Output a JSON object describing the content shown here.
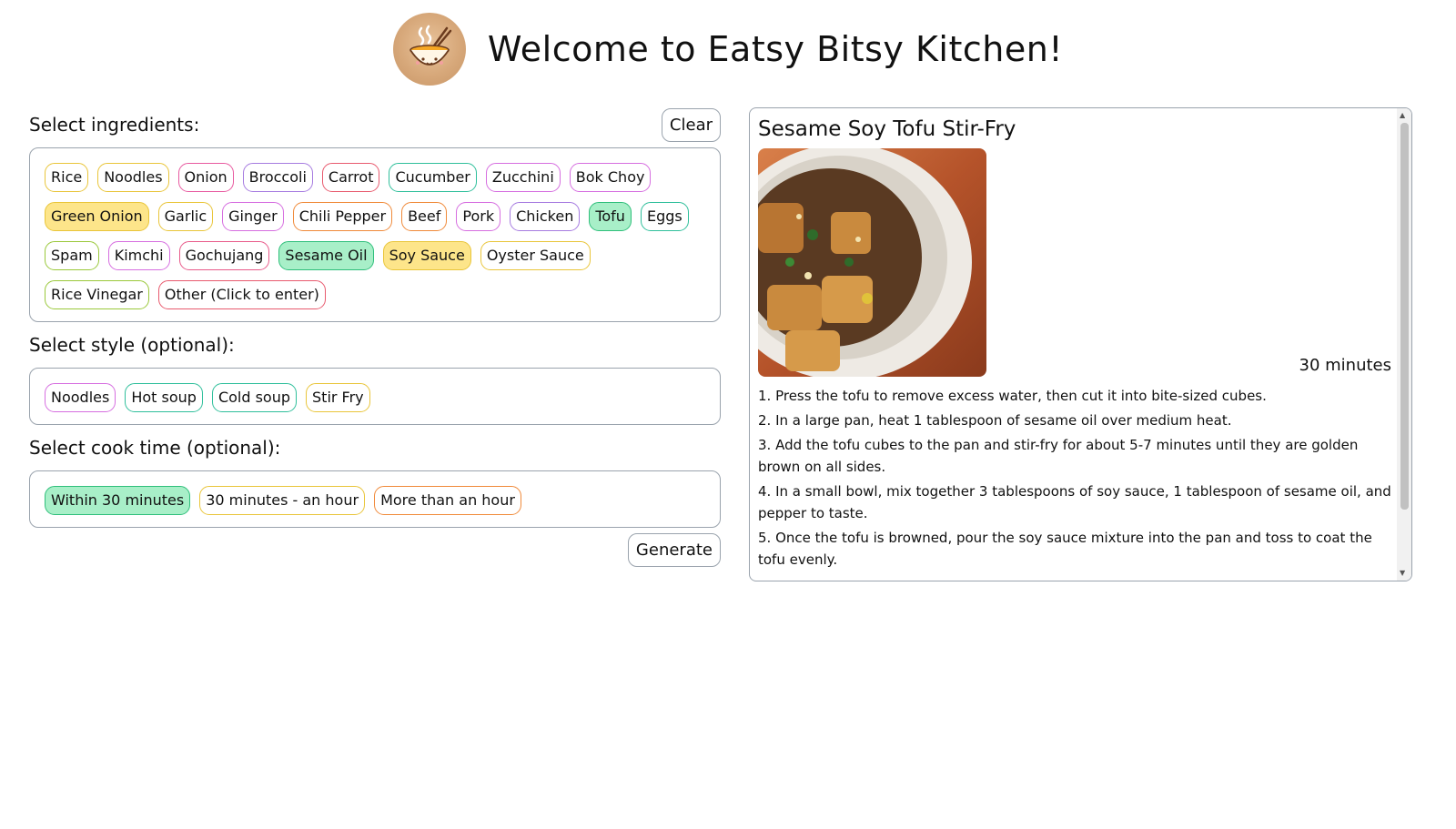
{
  "header": {
    "title": "Welcome to Eatsy Bitsy Kitchen!",
    "logo_icon": "noodle-bowl-icon"
  },
  "ingredients": {
    "label": "Select ingredients:",
    "clear_label": "Clear",
    "chips": [
      {
        "label": "Rice",
        "color": "#e9c53a",
        "selected": false
      },
      {
        "label": "Noodles",
        "color": "#e9c53a",
        "selected": false
      },
      {
        "label": "Onion",
        "color": "#e85aa0",
        "selected": false
      },
      {
        "label": "Broccoli",
        "color": "#a67be0",
        "selected": false
      },
      {
        "label": "Carrot",
        "color": "#e85a6e",
        "selected": false
      },
      {
        "label": "Cucumber",
        "color": "#2fbf9b",
        "selected": false
      },
      {
        "label": "Zucchini",
        "color": "#d66ee0",
        "selected": false
      },
      {
        "label": "Bok Choy",
        "color": "#d66ee0",
        "selected": false
      },
      {
        "label": "Green Onion",
        "color": "#e9c53a",
        "selected": true,
        "fill": "#fde58a"
      },
      {
        "label": "Garlic",
        "color": "#e9c53a",
        "selected": false
      },
      {
        "label": "Ginger",
        "color": "#d66ee0",
        "selected": false
      },
      {
        "label": "Chili Pepper",
        "color": "#f08a3a",
        "selected": false
      },
      {
        "label": "Beef",
        "color": "#f08a3a",
        "selected": false
      },
      {
        "label": "Pork",
        "color": "#d66ee0",
        "selected": false
      },
      {
        "label": "Chicken",
        "color": "#a67be0",
        "selected": false
      },
      {
        "label": "Tofu",
        "color": "#2fbf7b",
        "selected": true,
        "fill": "#a8efc8"
      },
      {
        "label": "Eggs",
        "color": "#2fbf9b",
        "selected": false
      },
      {
        "label": "Spam",
        "color": "#9ac83a",
        "selected": false
      },
      {
        "label": "Kimchi",
        "color": "#d66ee0",
        "selected": false
      },
      {
        "label": "Gochujang",
        "color": "#e85a8a",
        "selected": false
      },
      {
        "label": "Sesame Oil",
        "color": "#2fbf7b",
        "selected": true,
        "fill": "#a8efc8"
      },
      {
        "label": "Soy Sauce",
        "color": "#e9c53a",
        "selected": true,
        "fill": "#fde58a"
      },
      {
        "label": "Oyster Sauce",
        "color": "#e9c53a",
        "selected": false
      },
      {
        "label": "Rice Vinegar",
        "color": "#9ac83a",
        "selected": false
      },
      {
        "label": "Other (Click to enter)",
        "color": "#e85a6e",
        "selected": false
      }
    ]
  },
  "style": {
    "label": "Select style (optional):",
    "chips": [
      {
        "label": "Noodles",
        "color": "#d66ee0",
        "selected": false
      },
      {
        "label": "Hot soup",
        "color": "#2fbf9b",
        "selected": false
      },
      {
        "label": "Cold soup",
        "color": "#2fbf9b",
        "selected": false
      },
      {
        "label": "Stir Fry",
        "color": "#e9c53a",
        "selected": false
      }
    ]
  },
  "cooktime": {
    "label": "Select cook time (optional):",
    "chips": [
      {
        "label": "Within 30 minutes",
        "color": "#2fbf7b",
        "selected": true,
        "fill": "#a8efc8"
      },
      {
        "label": "30 minutes - an hour",
        "color": "#e9c53a",
        "selected": false
      },
      {
        "label": "More than an hour",
        "color": "#f08a3a",
        "selected": false
      }
    ]
  },
  "generate_label": "Generate",
  "recipe": {
    "title": "Sesame Soy Tofu Stir-Fry",
    "time": "30 minutes",
    "steps": [
      "1. Press the tofu to remove excess water, then cut it into bite-sized cubes.",
      "2. In a large pan, heat 1 tablespoon of sesame oil over medium heat.",
      "3. Add the tofu cubes to the pan and stir-fry for about 5-7 minutes until they are golden brown on all sides.",
      "4. In a small bowl, mix together 3 tablespoons of soy sauce, 1 tablespoon of sesame oil, and pepper to taste.",
      "5. Once the tofu is browned, pour the soy sauce mixture into the pan and toss to coat the tofu evenly."
    ]
  }
}
